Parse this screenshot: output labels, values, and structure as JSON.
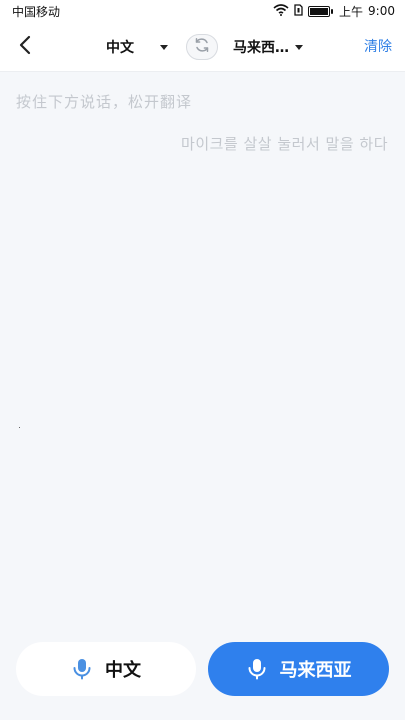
{
  "status_bar": {
    "carrier": "中国移动",
    "time_prefix": "上午",
    "time": "9:00"
  },
  "header": {
    "source_language": "中文",
    "target_language": "马来西…",
    "clear_label": "清除"
  },
  "content": {
    "hint_chinese": "按住下方说话，松开翻译",
    "hint_korean": "마이크를 살살 눌러서 말을 하다"
  },
  "bottom": {
    "left_button_label": "中文",
    "right_button_label": "马来西亚"
  },
  "colors": {
    "accent": "#2f80ed",
    "background": "#f5f7fa",
    "hint_text": "#c4c8ce"
  },
  "icons": [
    "back-icon",
    "swap-icon",
    "microphone-icon",
    "wifi-icon",
    "battery-icon"
  ]
}
